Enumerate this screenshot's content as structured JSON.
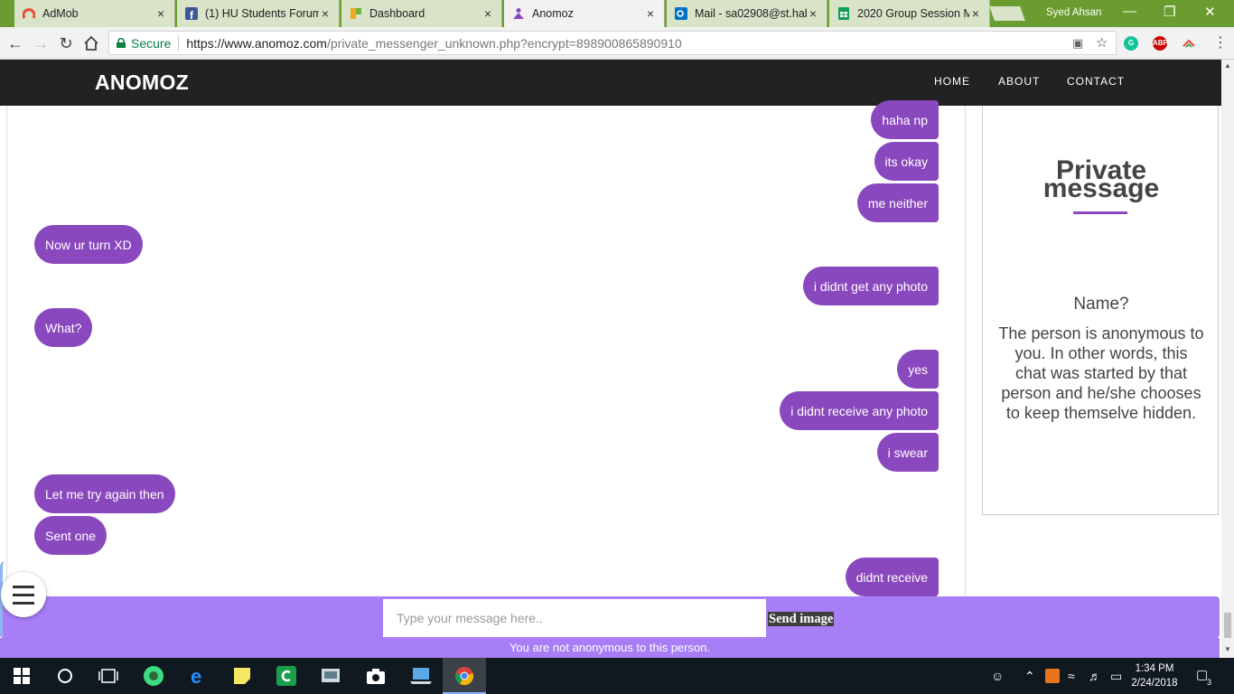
{
  "browser": {
    "tabs": [
      {
        "label": "AdMob",
        "close": "×"
      },
      {
        "label": "(1) HU Students Forum",
        "close": "×"
      },
      {
        "label": "Dashboard",
        "close": "×"
      },
      {
        "label": "Anomoz",
        "close": "×"
      },
      {
        "label": "Mail - sa02908@st.hab",
        "close": "×"
      },
      {
        "label": "2020 Group Session M",
        "close": "×"
      }
    ],
    "profile_name": "Syed Ahsan",
    "secure_label": "Secure",
    "url_host": "https://www.anomoz.com",
    "url_path": "/private_messenger_unknown.php?encrypt=898900865890910",
    "abp_label": "ABP"
  },
  "site": {
    "brand": "ANOMOZ",
    "nav": {
      "home": "HOME",
      "about": "ABOUT",
      "contact": "CONTACT"
    }
  },
  "chat": {
    "messages": [
      {
        "text": "haha np",
        "from": "me"
      },
      {
        "text": "its okay",
        "from": "me"
      },
      {
        "text": "me neither",
        "from": "me"
      },
      {
        "text": "Now ur turn XD",
        "from": "them"
      },
      {
        "text": "i didnt get any photo",
        "from": "me"
      },
      {
        "text": "What?",
        "from": "them"
      },
      {
        "text": "yes",
        "from": "me"
      },
      {
        "text": "i didnt receive any photo",
        "from": "me"
      },
      {
        "text": "i swear",
        "from": "me"
      },
      {
        "text": "Let me try again then",
        "from": "them"
      },
      {
        "text": "Sent one",
        "from": "them"
      },
      {
        "text": "didnt receive",
        "from": "me"
      }
    ],
    "input_placeholder": "Type your message here..",
    "send_image_label": "Send image",
    "notice": "You are not anonymous to this person."
  },
  "sidebar": {
    "title_line1": "Private",
    "title_line2": "message",
    "name_label": "Name?",
    "description": "The person is anonymous to you. In other words, this chat was started by that person and he/she chooses to keep themselve hidden."
  },
  "taskbar": {
    "time": "1:34 PM",
    "date": "2/24/2018",
    "notification_count": "3"
  },
  "colors": {
    "bubble": "#8a48be",
    "input_bar": "#a77ef6",
    "navbar": "#222222",
    "tab_strip": "#6b9c2f"
  }
}
